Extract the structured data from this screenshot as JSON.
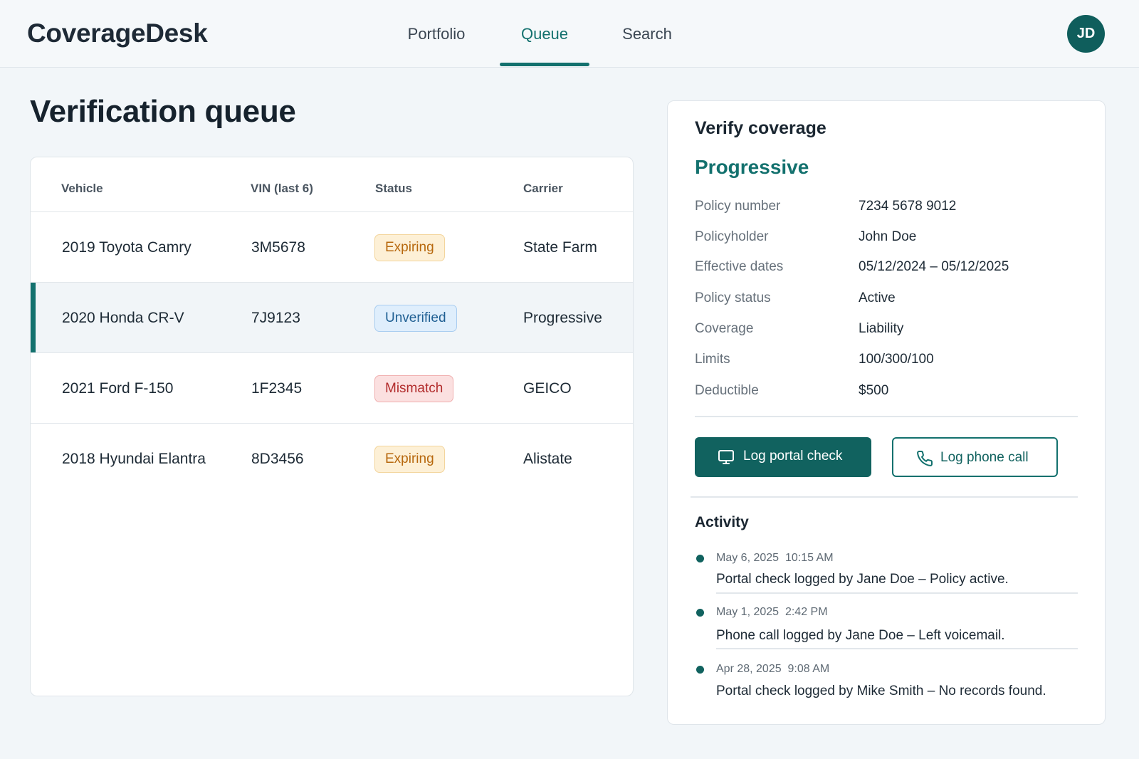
{
  "app": {
    "brand": "CoverageDesk",
    "user_initials": "JD"
  },
  "nav": {
    "items": [
      {
        "label": "Portfolio"
      },
      {
        "label": "Queue",
        "active": true
      },
      {
        "label": "Search"
      }
    ]
  },
  "page": {
    "title": "Verification queue"
  },
  "queue": {
    "columns": [
      "Vehicle",
      "VIN (last 6)",
      "Status",
      "Carrier"
    ],
    "rows": [
      {
        "vehicle": "2019 Toyota Camry",
        "vin": "3M5678",
        "status": "Expiring",
        "status_type": "expiring",
        "carrier": "State Farm",
        "selected": false
      },
      {
        "vehicle": "2020 Honda CR-V",
        "vin": "7J9123",
        "status": "Unverified",
        "status_type": "unverified",
        "carrier": "Progressive",
        "selected": true
      },
      {
        "vehicle": "2021 Ford F-150",
        "vin": "1F2345",
        "status": "Mismatch",
        "status_type": "mismatch",
        "carrier": "GEICO",
        "selected": false
      },
      {
        "vehicle": "2018 Hyundai Elantra",
        "vin": "8D3456",
        "status": "Expiring",
        "status_type": "expiring",
        "carrier": "Alistate",
        "selected": false
      }
    ]
  },
  "verify": {
    "title": "Verify coverage",
    "carrier": "Progressive",
    "details": [
      {
        "label": "Policy number",
        "value": "7234 5678 9012"
      },
      {
        "label": "Policyholder",
        "value": "John Doe"
      },
      {
        "label": "Effective dates",
        "value": "05/12/2024 – 05/12/2025"
      },
      {
        "label": "Policy status",
        "value": "Active"
      },
      {
        "label": "Coverage",
        "value": "Liability"
      },
      {
        "label": "Limits",
        "value": "100/300/100"
      },
      {
        "label": "Deductible",
        "value": "$500"
      }
    ],
    "buttons": {
      "portal": {
        "label": "Log portal check",
        "icon": "monitor-icon"
      },
      "phone": {
        "label": "Log phone call",
        "icon": "phone-icon"
      }
    }
  },
  "activity": {
    "title": "Activity",
    "entries": [
      {
        "date": "May 6, 2025",
        "time": "10:15 AM",
        "text": "Portal check logged by Jane Doe – Policy active."
      },
      {
        "date": "May 1, 2025",
        "time": "2:42 PM",
        "text": "Phone call logged by Jane Doe – Left voicemail."
      },
      {
        "date": "Apr 28, 2025",
        "time": "9:08 AM",
        "text": "Portal check logged by Mike Smith – No records found."
      }
    ]
  },
  "colors": {
    "accent": "#13716e",
    "primary_button": "#11625f",
    "expiring": "#b7680d",
    "unverified": "#1f5f93",
    "mismatch": "#b22c2c"
  }
}
